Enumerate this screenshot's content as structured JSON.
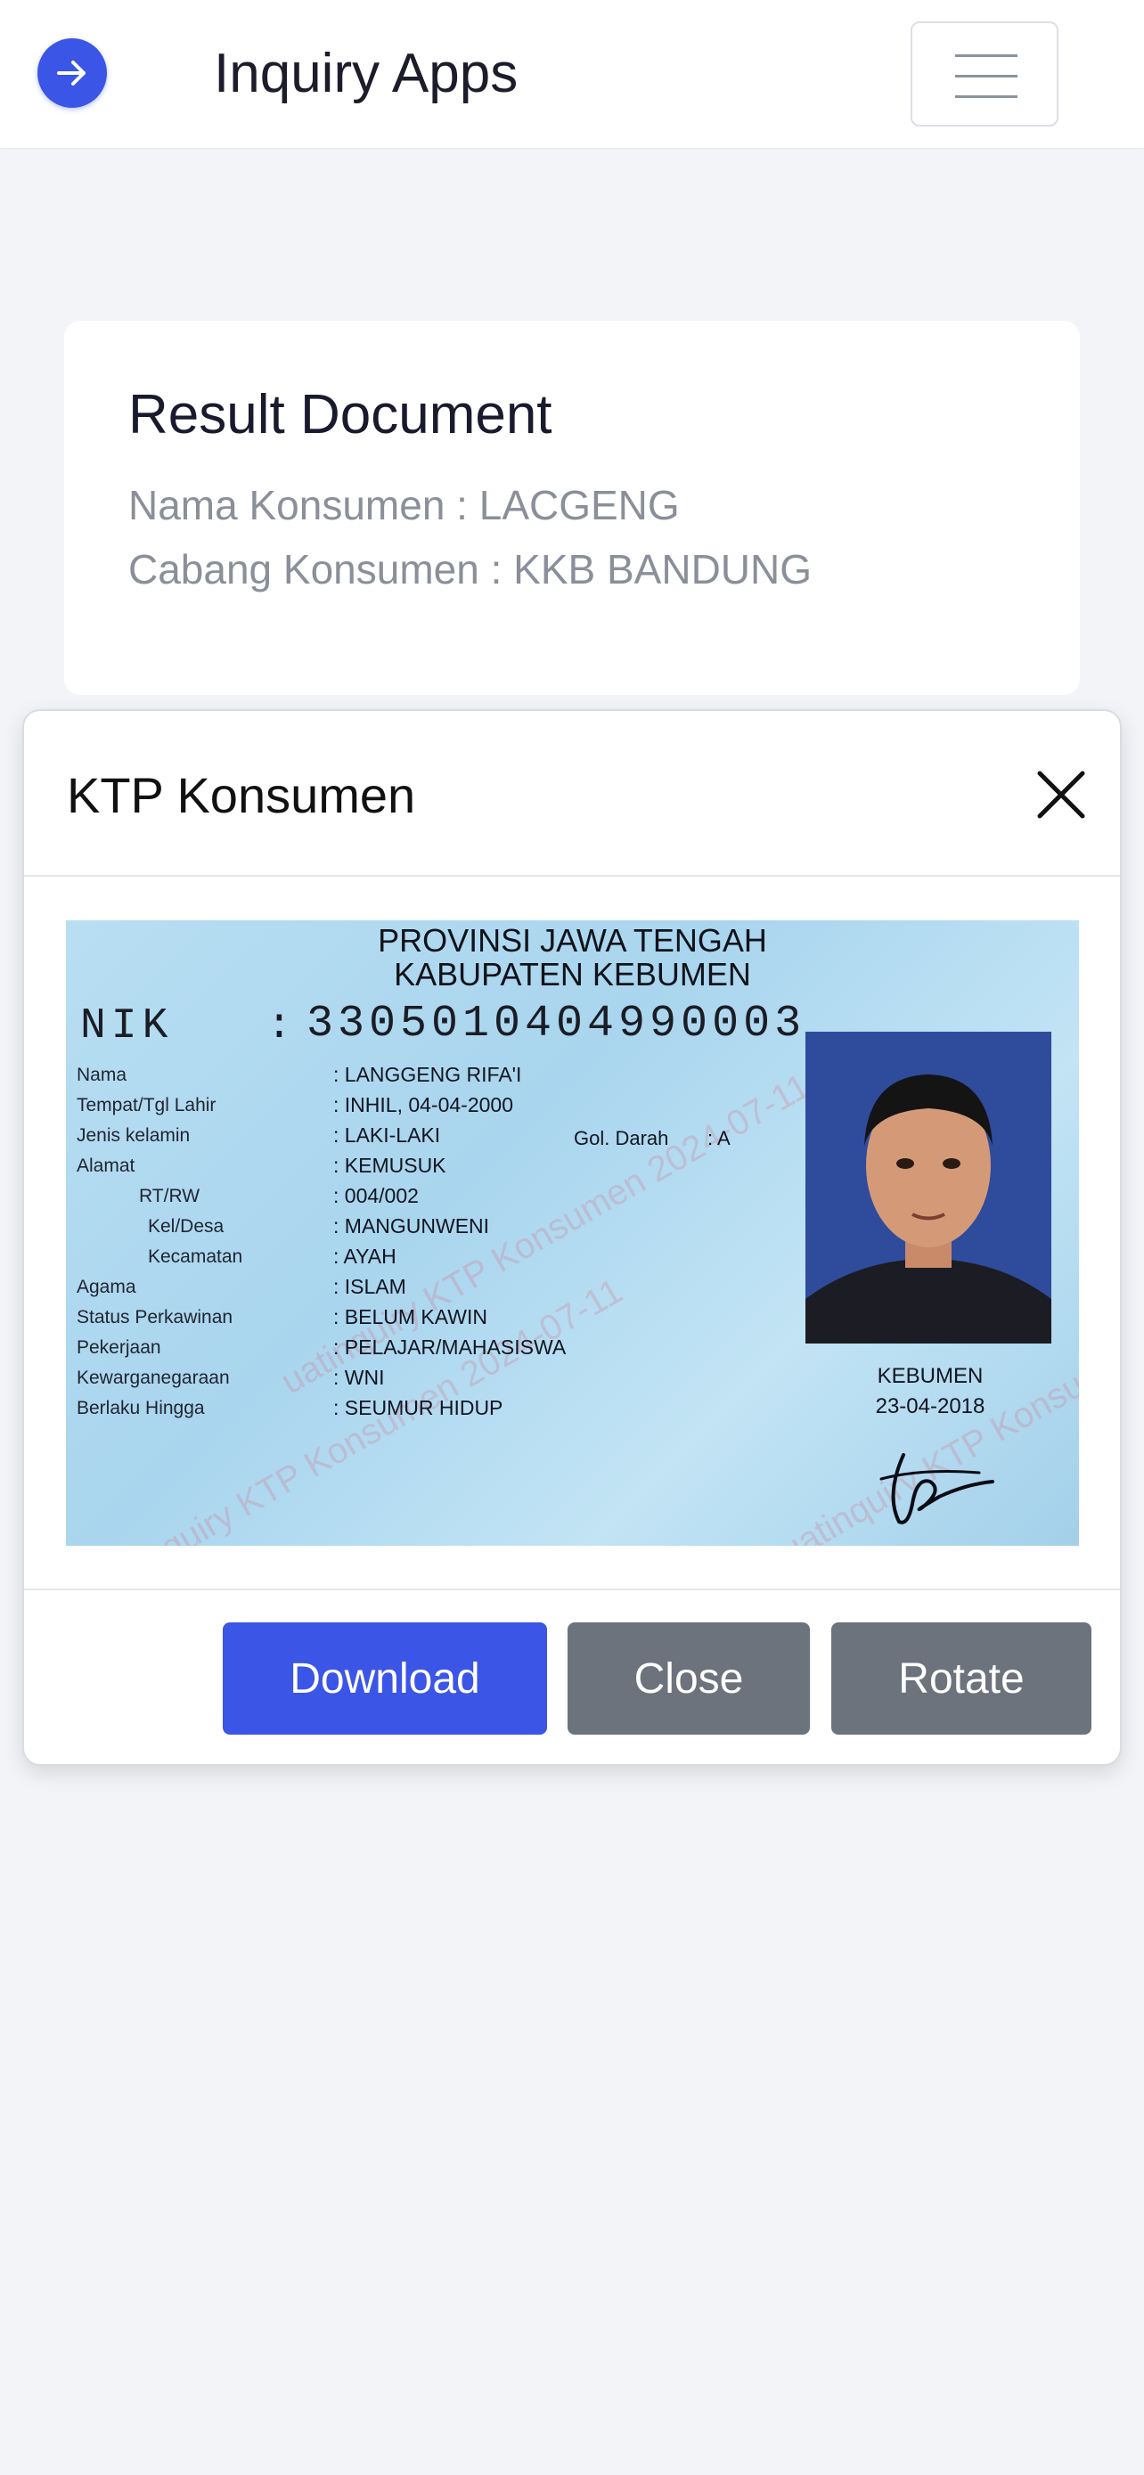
{
  "navbar": {
    "title": "Inquiry Apps"
  },
  "result": {
    "title": "Result Document",
    "nama_line": "Nama Konsumen : LACGENG",
    "cabang_line": "Cabang Konsumen : KKB BANDUNG"
  },
  "modal": {
    "title": "KTP Konsumen",
    "buttons": {
      "download": "Download",
      "close": "Close",
      "rotate": "Rotate"
    }
  },
  "ktp": {
    "province": "PROVINSI JAWA TENGAH",
    "regency": "KABUPATEN KEBUMEN",
    "nik_label": "NIK",
    "nik_sep": ":",
    "nik": "3305010404990003",
    "fields": [
      {
        "label": "Nama",
        "value": ": LANGGENG RIFA'I"
      },
      {
        "label": "Tempat/Tgl Lahir",
        "value": ": INHIL, 04-04-2000"
      },
      {
        "label": "Jenis kelamin",
        "value": ": LAKI-LAKI"
      },
      {
        "label": "Alamat",
        "value": ": KEMUSUK"
      },
      {
        "label": "RT/RW",
        "value": ": 004/002"
      },
      {
        "label": "Kel/Desa",
        "value": ": MANGUNWENI"
      },
      {
        "label": "Kecamatan",
        "value": ": AYAH"
      },
      {
        "label": "Agama",
        "value": ": ISLAM"
      },
      {
        "label": "Status Perkawinan",
        "value": ": BELUM KAWIN"
      },
      {
        "label": "Pekerjaan",
        "value": ": PELAJAR/MAHASISWA"
      },
      {
        "label": "Kewarganegaraan",
        "value": ": WNI"
      },
      {
        "label": "Berlaku Hingga",
        "value": ": SEUMUR HIDUP"
      }
    ],
    "gol_darah_label": "Gol. Darah",
    "gol_darah_value": ": A",
    "issue_place": "KEBUMEN",
    "issue_date": "23-04-2018",
    "watermark": "uatinquiry KTP Konsumen 2024-07-11"
  },
  "colors": {
    "primary": "#3b55e6",
    "secondary": "#6c737d",
    "background": "#f2f4f8"
  }
}
